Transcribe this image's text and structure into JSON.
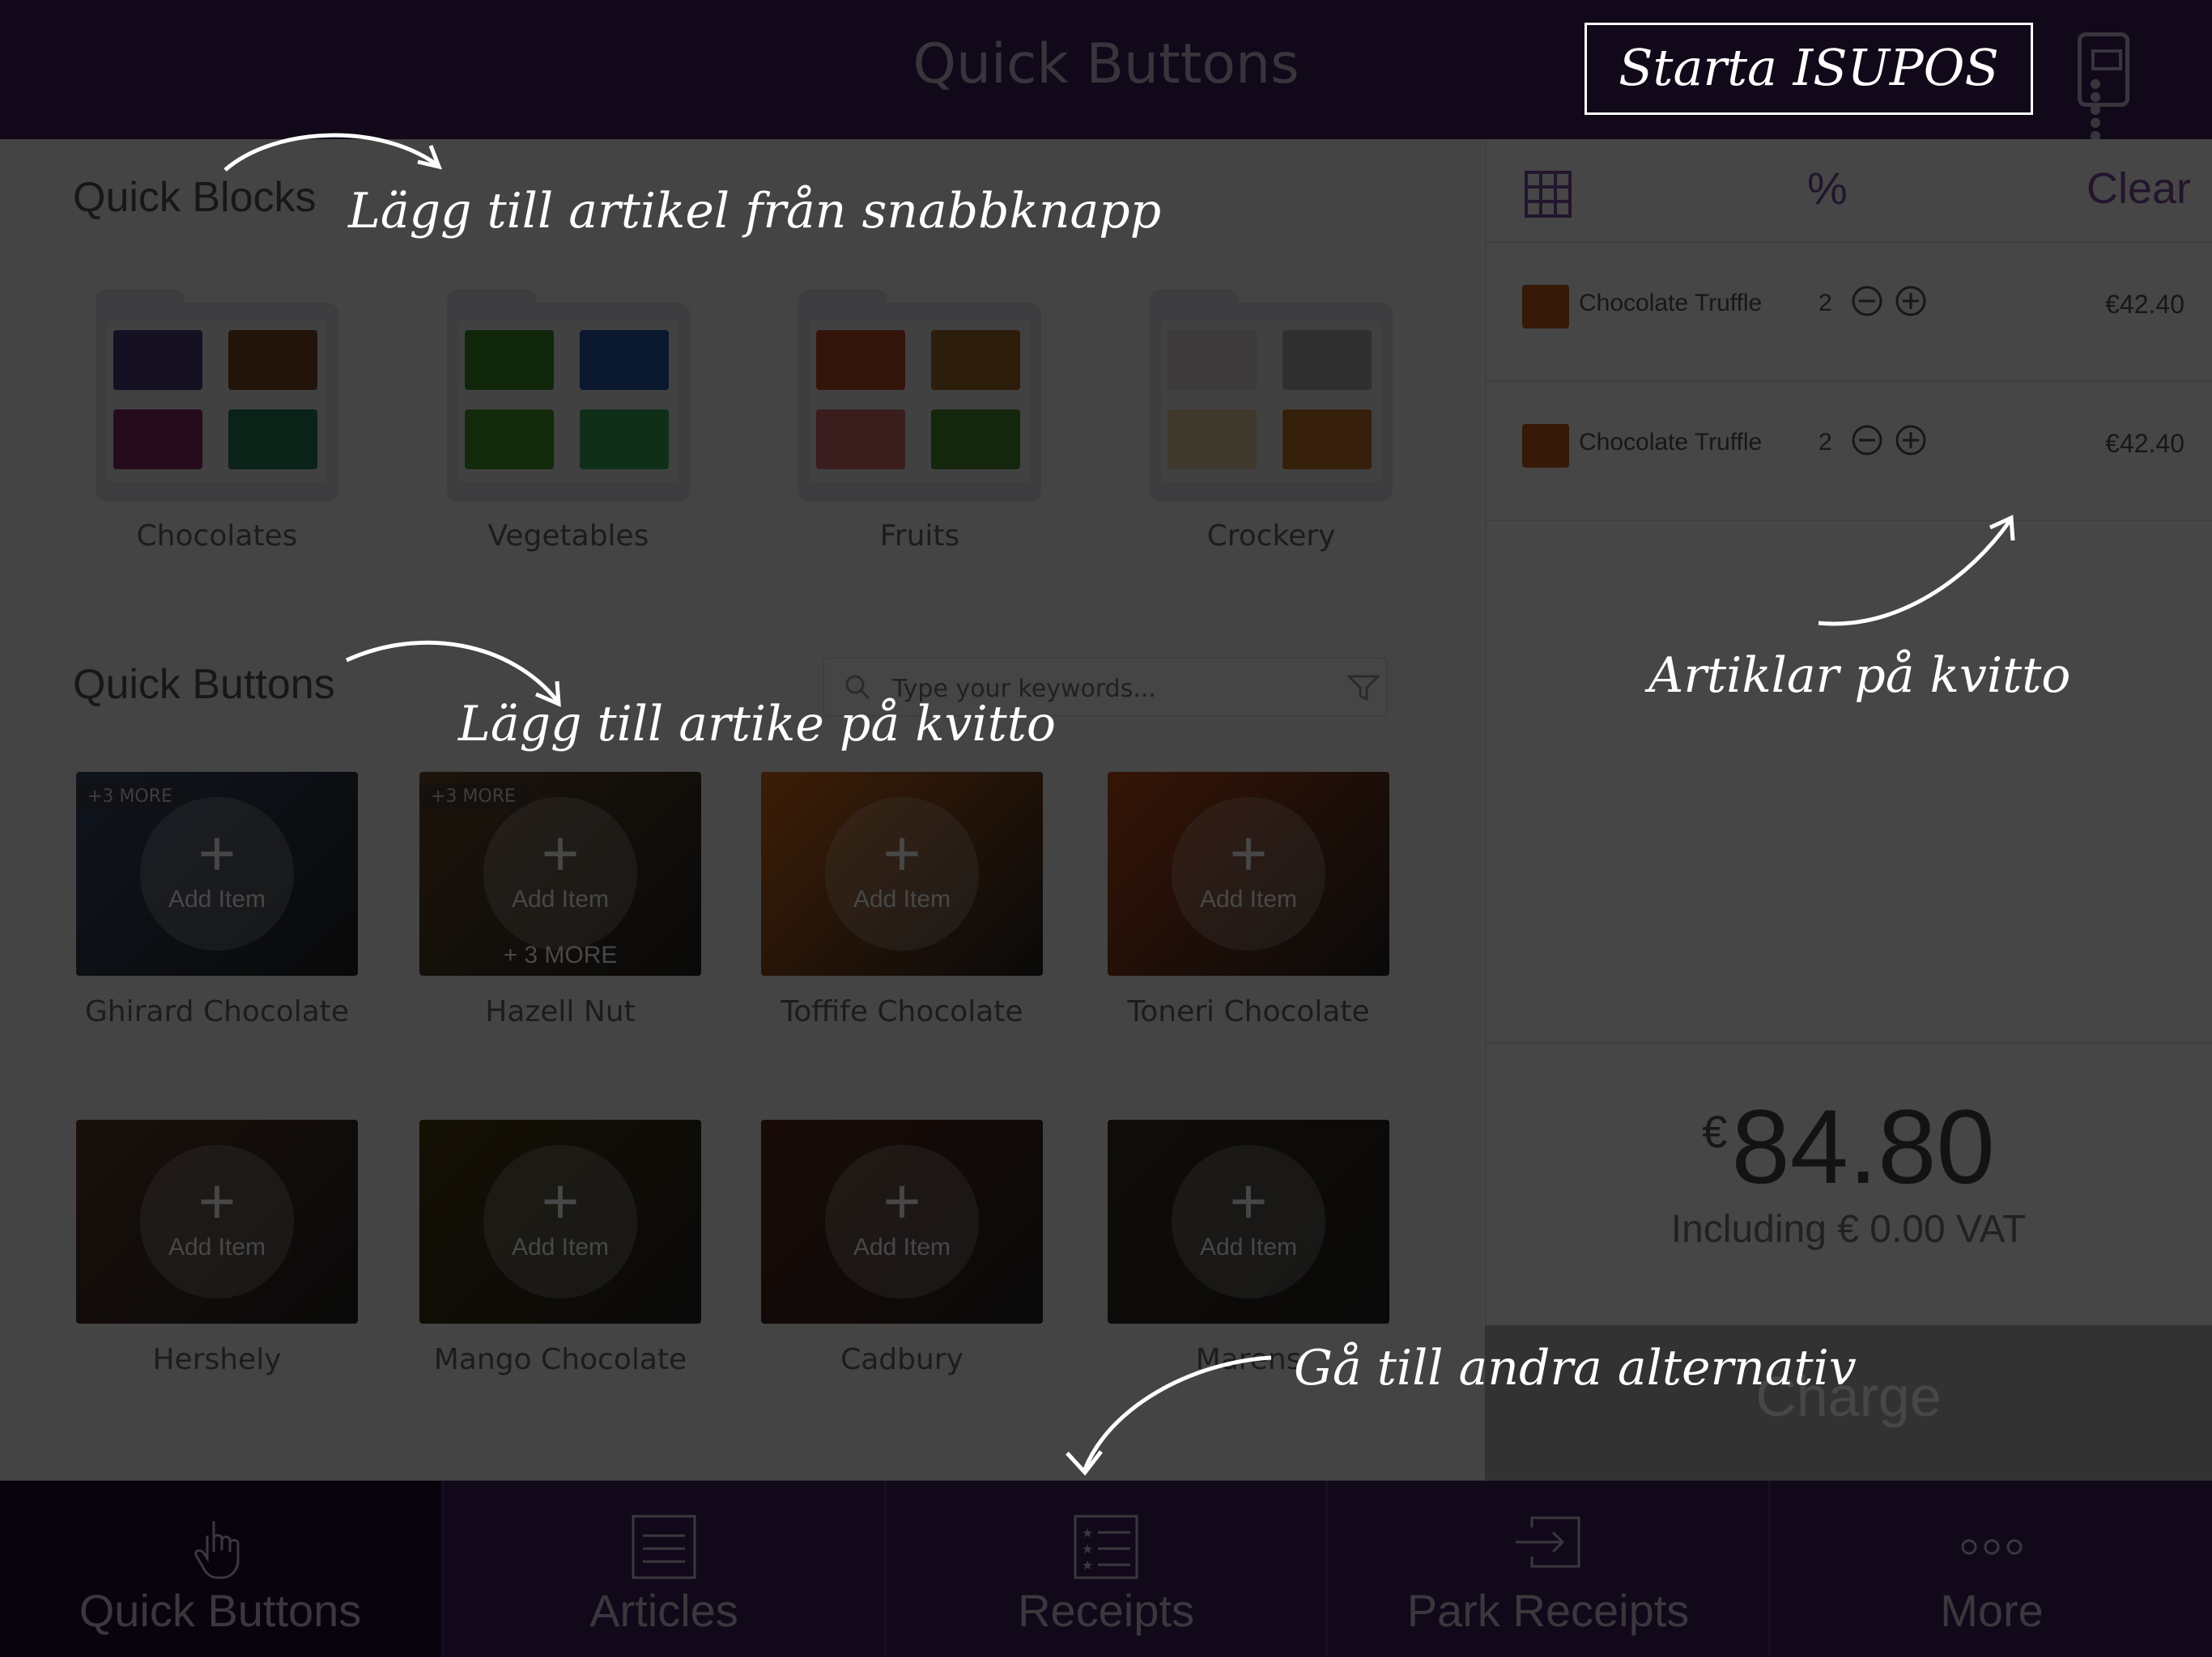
{
  "topbar": {
    "title": "Quick Buttons",
    "start_button": "Starta ISUPOS",
    "device_icon": "pos-terminal-icon"
  },
  "quick_blocks": {
    "heading": "Quick Blocks",
    "items": [
      {
        "label": "Chocolates",
        "thumb_colors": [
          "#4b3a7a",
          "#7a4a2a",
          "#8a2a6a",
          "#2a7a5a"
        ]
      },
      {
        "label": "Vegetables",
        "thumb_colors": [
          "#3a8a2a",
          "#2a5aaa",
          "#4a9a2a",
          "#3aaa5a"
        ]
      },
      {
        "label": "Fruits",
        "thumb_colors": [
          "#b84a2a",
          "#a06a2a",
          "#d06a6a",
          "#4a8a2a"
        ]
      },
      {
        "label": "Crockery",
        "thumb_colors": [
          "#d8d0d0",
          "#aaaaaa",
          "#e0c8a0",
          "#c0702a"
        ]
      }
    ]
  },
  "quick_buttons": {
    "heading": "Quick Buttons",
    "search_placeholder": "Type your keywords...",
    "add_label": "Add Item",
    "items": [
      {
        "label": "Ghirard Chocolate",
        "badge": "+3 MORE",
        "bottom_more": "",
        "bg": "#3a4a6a"
      },
      {
        "label": "Hazell Nut",
        "badge": "+3 MORE",
        "bottom_more": "+ 3 MORE",
        "bg": "#6a4a2a"
      },
      {
        "label": "Toffife Chocolate",
        "badge": "",
        "bottom_more": "",
        "bg": "#d86a1a"
      },
      {
        "label": "Toneri Chocolate",
        "badge": "",
        "bottom_more": "",
        "bg": "#c04a1a"
      },
      {
        "label": "Hershely",
        "badge": "",
        "bottom_more": "",
        "bg": "#5a3a2a"
      },
      {
        "label": "Mango Chocolate",
        "badge": "",
        "bottom_more": "",
        "bg": "#4a3a10"
      },
      {
        "label": "Cadbury",
        "badge": "",
        "bottom_more": "",
        "bg": "#5a2a1a"
      },
      {
        "label": "Marens",
        "badge": "",
        "bottom_more": "",
        "bg": "#3a3020"
      }
    ]
  },
  "receipt": {
    "grid_icon": "grid-icon",
    "percent": "%",
    "clear": "Clear",
    "lines": [
      {
        "name": "Chocolate Truffle",
        "qty": "2",
        "price": "€42.40"
      },
      {
        "name": "Chocolate Truffle",
        "qty": "2",
        "price": "€42.40"
      }
    ],
    "currency": "€",
    "total": "84.80",
    "vat": "Including € 0.00 VAT",
    "charge": "Charge"
  },
  "nav": [
    {
      "label": "Quick Buttons",
      "icon": "hand-pointer-icon"
    },
    {
      "label": "Articles",
      "icon": "list-icon"
    },
    {
      "label": "Receipts",
      "icon": "receipt-list-icon"
    },
    {
      "label": "Park Receipts",
      "icon": "park-receipt-icon"
    },
    {
      "label": "More",
      "icon": "more-dots-icon"
    }
  ],
  "hints": {
    "quick_blocks": "Lägg till artikel från snabbknapp",
    "quick_buttons": "Lägg till artike på kvitto",
    "receipt": "Artiklar på kvitto",
    "nav": "Gå till andra alternativ"
  }
}
